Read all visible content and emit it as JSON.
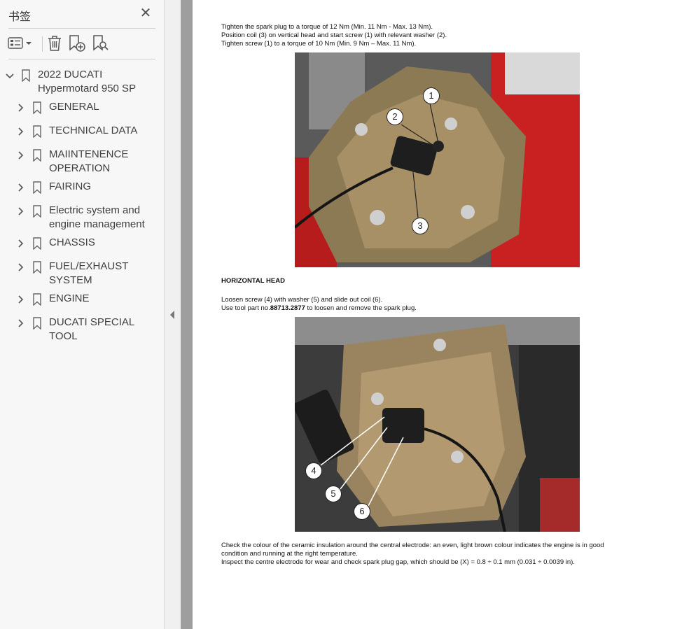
{
  "sidebar": {
    "title": "书签",
    "close_icon": "close-icon",
    "toolbar": [
      "options-icon",
      "delete-icon",
      "new-bookmark-icon",
      "find-bookmark-icon"
    ],
    "bookmarks": [
      {
        "label": "2022 DUCATI\nHypermotard 950 SP",
        "expanded": true
      },
      {
        "label": "GENERAL"
      },
      {
        "label": "TECHNICAL DATA"
      },
      {
        "label": "MAIINTENENCE\nOPERATION"
      },
      {
        "label": "FAIRING"
      },
      {
        "label": "Electric system and\nengine management"
      },
      {
        "label": "CHASSIS"
      },
      {
        "label": "FUEL/EXHAUST\nSYSTEM"
      },
      {
        "label": "ENGINE"
      },
      {
        "label": "DUCATI SPECIAL TOOL"
      }
    ]
  },
  "document": {
    "intro_lines": "Tighten the spark plug to a torque of 12 Nm (Min. 11 Nm - Max. 13 Nm).\nPosition coil (3) on vertical head and start screw (1) with relevant washer (2).\nTighten screw (1) to a torque of 10 Nm (Min. 9 Nm – Max. 11 Nm).",
    "figure1_callouts": [
      "1",
      "2",
      "3"
    ],
    "section_heading": "HORIZONTAL HEAD",
    "horizontal_line1": "Loosen screw (4) with washer (5) and slide out coil (6).",
    "horizontal_line2_prefix": "Use tool part no.",
    "horizontal_line2_part": "88713.2877",
    "horizontal_line2_suffix": " to loosen and remove the spark plug.",
    "figure2_callouts": [
      "4",
      "5",
      "6"
    ],
    "closing_lines": "Check the colour of the ceramic insulation around the central electrode: an even, light brown colour indicates the engine is in good\ncondition and running at the right temperature.\nInspect the centre electrode for wear and check spark plug gap, which should be (X) = 0.8 ÷ 0.1 mm (0.031 ÷ 0.0039 in)."
  }
}
